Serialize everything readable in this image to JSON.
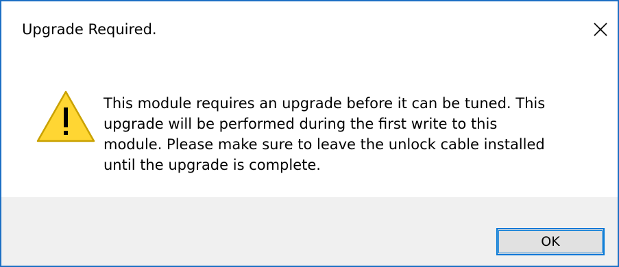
{
  "dialog": {
    "title": "Upgrade Required.",
    "message": "This module requires an upgrade before it can be tuned. This\nupgrade will be performed during the first write to this\nmodule. Please make sure to leave the unlock cable installed\nuntil the upgrade is complete.",
    "ok_label": "OK",
    "icon": "warning-icon",
    "close_icon": "close-icon"
  },
  "colors": {
    "window_border": "#1c6fc4",
    "footer_background": "#f0f0f0",
    "button_border": "#0078d7",
    "button_background": "#e1e1e1",
    "warning_fill": "#ffd633",
    "warning_outline": "#c9a100"
  }
}
